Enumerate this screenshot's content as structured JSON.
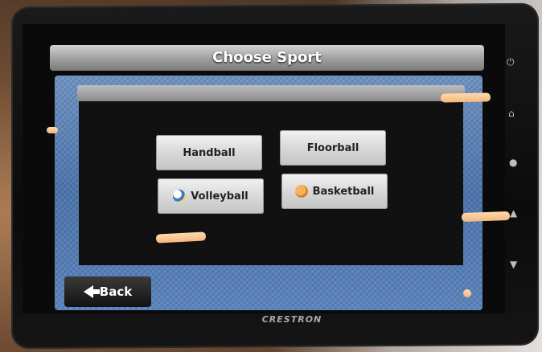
{
  "screen": {
    "title": "Choose Sport",
    "brand": "CRESTRON"
  },
  "sports": [
    {
      "label": "Handball",
      "icon": null
    },
    {
      "label": "Floorball",
      "icon": null
    },
    {
      "label": "Volleyball",
      "icon": "volleyball-icon"
    },
    {
      "label": "Basketball",
      "icon": "basketball-icon"
    }
  ],
  "back_button": {
    "label": "Back",
    "icon": "back-arrow-icon"
  },
  "side_icons": [
    "power-icon",
    "home-icon",
    "light-icon",
    "volume-up-icon",
    "volume-down-icon"
  ],
  "colors": {
    "panel_blue": "#5c85bf",
    "title_bar": "#9e9e9e",
    "button": "#d6d6d6",
    "tape": "#f3b87c"
  }
}
